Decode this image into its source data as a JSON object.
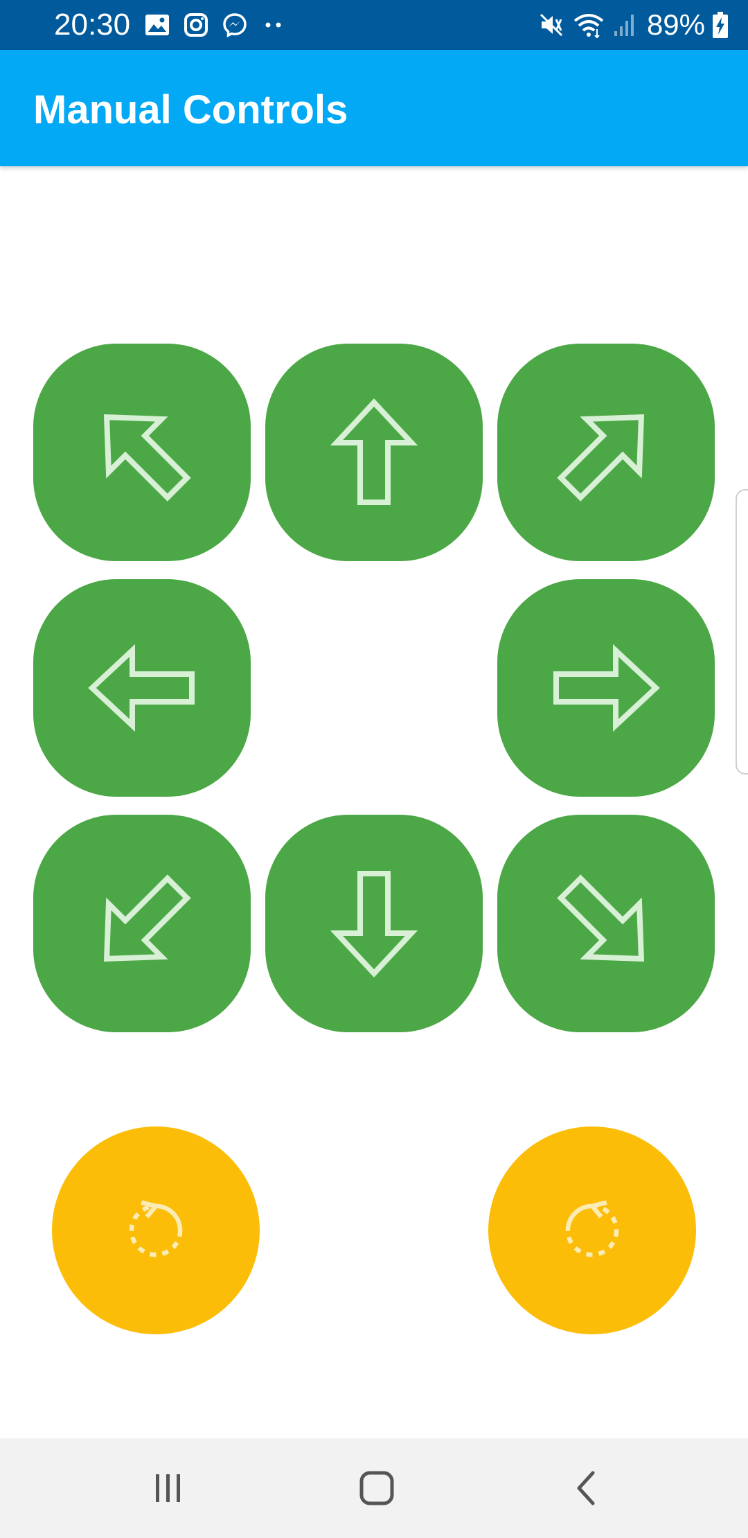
{
  "status_bar": {
    "time": "20:30",
    "battery_percent": "89%",
    "icons_left": [
      "image-icon",
      "instagram-icon",
      "messenger-icon",
      "more-dots-icon"
    ],
    "icons_right": [
      "vibrate-mute-icon",
      "wifi-icon",
      "signal-icon",
      "battery-charging-icon"
    ]
  },
  "app_bar": {
    "title": "Manual Controls"
  },
  "direction_pad": {
    "buttons": [
      "up-left",
      "up",
      "up-right",
      "left",
      "right",
      "down-left",
      "down",
      "down-right"
    ],
    "color": "#4CA746",
    "arrow_color": "#D8F0D6"
  },
  "rotate_controls": {
    "buttons": [
      "rotate-counterclockwise",
      "rotate-clockwise"
    ],
    "color": "#FBBD08"
  },
  "navigation_bar": {
    "buttons": [
      "recents",
      "home",
      "back"
    ]
  },
  "colors": {
    "status_bar": "#005A9C",
    "app_bar": "#03A9F4"
  }
}
